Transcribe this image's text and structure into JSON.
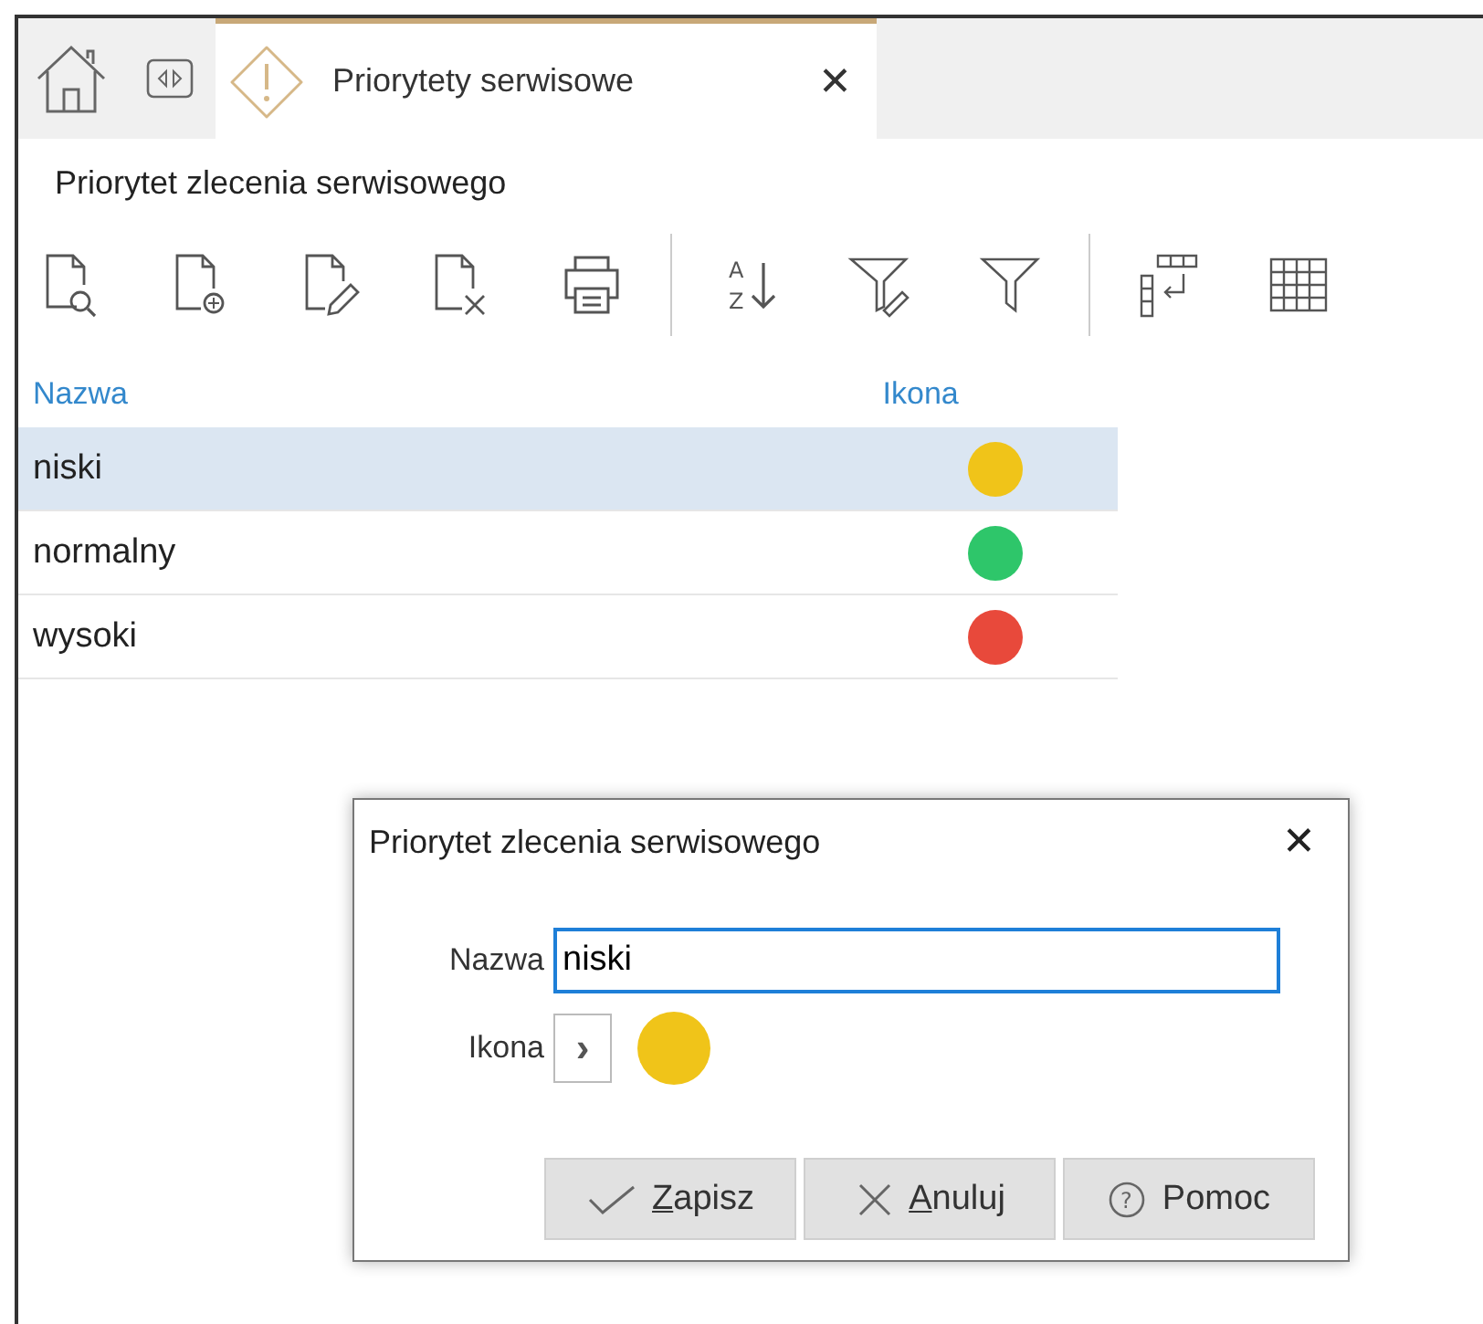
{
  "tabs": [
    {
      "kind": "home",
      "selected": false
    },
    {
      "kind": "switch",
      "selected": false
    },
    {
      "kind": "document",
      "label": "Priorytety serwisowe",
      "close": "✕",
      "selected": true
    }
  ],
  "section_title": "Priorytet zlecenia serwisowego",
  "sort_icon": {
    "top": "A",
    "bottom": "Z"
  },
  "table": {
    "columns": [
      "Nazwa",
      "Ikona"
    ],
    "rows": [
      {
        "name": "niski",
        "color": "#f0c419",
        "selected": true
      },
      {
        "name": "normalny",
        "color": "#2ec66a",
        "selected": false
      },
      {
        "name": "wysoki",
        "color": "#e8493b",
        "selected": false
      }
    ]
  },
  "dialog": {
    "title": "Priorytet zlecenia serwisowego",
    "close": "✕",
    "fields": [
      {
        "kind": "text",
        "label": "Nazwa",
        "value": "niski"
      },
      {
        "kind": "icon",
        "label": "Ikona",
        "button": "›",
        "color": "#f0c419"
      }
    ],
    "buttons": [
      {
        "kind": "save",
        "label": "Zapisz",
        "underline_first": true
      },
      {
        "kind": "cancel",
        "label": "Anuluj",
        "underline_first": true
      },
      {
        "kind": "help",
        "label": "Pomoc",
        "icon_text": "?",
        "underline_first": false
      }
    ]
  }
}
